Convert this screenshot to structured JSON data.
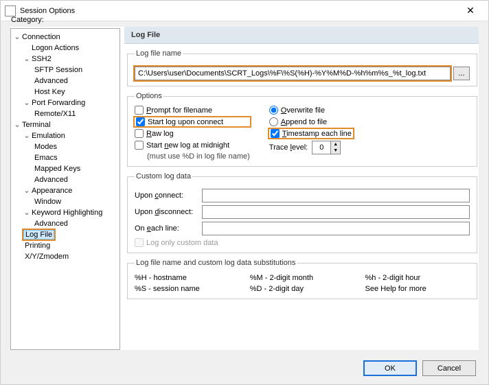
{
  "window": {
    "title": "Session Options"
  },
  "categoryLabel": "Category:",
  "tree": {
    "connection": "Connection",
    "logonActions": "Logon Actions",
    "ssh2": "SSH2",
    "sftp": "SFTP Session",
    "advanced1": "Advanced",
    "hostkey": "Host Key",
    "portfwd": "Port Forwarding",
    "remotex11": "Remote/X11",
    "terminal": "Terminal",
    "emulation": "Emulation",
    "modes": "Modes",
    "emacs": "Emacs",
    "mapped": "Mapped Keys",
    "advanced2": "Advanced",
    "appearance": "Appearance",
    "windowi": "Window",
    "keyword": "Keyword Highlighting",
    "advanced3": "Advanced",
    "logfile": "Log File",
    "printing": "Printing",
    "xyz": "X/Y/Zmodem"
  },
  "header": "Log File",
  "logfilename": {
    "legend": "Log file name",
    "value": "C:\\Users\\user\\Documents\\SCRT_Logs\\%F\\%S(%H)-%Y%M%D-%h%m%s_%t_log.txt",
    "browse": "..."
  },
  "options": {
    "legend": "Options",
    "promptFilename": "Prompt for filename",
    "startUpon": "Start log upon connect",
    "rawlog": "Raw log",
    "startMidnight": "Start new log at midnight",
    "mustusepd": "(must use %D in log file name)",
    "overwrite": "Overwrite file",
    "append": "Append to file",
    "timestamp": "Timestamp each line",
    "tracelevel": "Trace level:",
    "traceval": "0"
  },
  "custom": {
    "legend": "Custom log data",
    "uponConnect": "Upon connect:",
    "uponDisconnect": "Upon disconnect:",
    "onEachLine": "On each line:",
    "logOnly": "Log only custom data"
  },
  "subs": {
    "legend": "Log file name and custom log data substitutions",
    "c1a": "%H - hostname",
    "c2a": "%M - 2-digit month",
    "c3a": "%h - 2-digit hour",
    "c1b": "%S - session name",
    "c2b": "%D - 2-digit day",
    "c3b": "See Help for more"
  },
  "buttons": {
    "ok": "OK",
    "cancel": "Cancel"
  }
}
